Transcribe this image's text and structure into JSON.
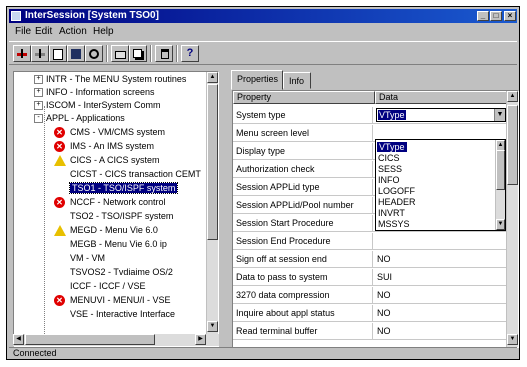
{
  "window": {
    "title": "InterSession [System TSO0]"
  },
  "menu": [
    "File",
    "Edit",
    "Action",
    "Help"
  ],
  "toolbar_icons": [
    "connect-icon",
    "disconnect-icon",
    "new-icon",
    "save-icon",
    "refresh-icon",
    "print-icon",
    "copy-icon",
    "delete-icon",
    "help-icon"
  ],
  "tree": [
    {
      "label": "INTR - The MENU System routines",
      "expander": "+",
      "level": 1
    },
    {
      "label": "INFO - Information screens",
      "expander": "+",
      "level": 1
    },
    {
      "label": "ISCOM - InterSystem Comm",
      "expander": "+",
      "level": 1
    },
    {
      "label": "APPL - Applications",
      "expander": "-",
      "level": 1
    },
    {
      "label": "CMS - VM/CMS system",
      "icon": "stop-icon",
      "level": 2
    },
    {
      "label": "IMS - An IMS system",
      "icon": "stop-icon",
      "level": 2
    },
    {
      "label": "CICS - A CICS system",
      "icon": "warning-icon",
      "level": 2
    },
    {
      "label": "CICST - CICS transaction CEMT",
      "level": 2
    },
    {
      "label": "TSO1 - TSO/ISPF system",
      "level": 2,
      "selected": true
    },
    {
      "label": "NCCF - Network control",
      "icon": "stop-icon",
      "level": 2
    },
    {
      "label": "TSO2 - TSO/ISPF system",
      "level": 2
    },
    {
      "label": "MEGD - Menu Vie 6.0",
      "icon": "warning-icon",
      "level": 2
    },
    {
      "label": "MEGB - Menu Vie 6.0 ip",
      "level": 2
    },
    {
      "label": "VM - VM",
      "level": 2
    },
    {
      "label": "TSVOS2 - Tvdiaime OS/2",
      "level": 2
    },
    {
      "label": "ICCF - ICCF / VSE",
      "level": 2
    },
    {
      "label": "MENUVI - MENU/I - VSE",
      "icon": "stop-icon",
      "level": 2
    },
    {
      "label": "VSE - Interactive Interface",
      "level": 2
    }
  ],
  "tabs": [
    "Properties",
    "Info"
  ],
  "grid": {
    "headers": [
      "Property",
      "Data"
    ],
    "rows": [
      {
        "property": "System type",
        "value": "VType",
        "combo": true
      },
      {
        "property": "Menu screen level",
        "value": ""
      },
      {
        "property": "Display type",
        "value": ""
      },
      {
        "property": "Authorization check",
        "value": ""
      },
      {
        "property": "Session APPLid type",
        "value": ""
      },
      {
        "property": "Session APPLid/Pool number",
        "value": ""
      },
      {
        "property": "Session Start Procedure",
        "value": ""
      },
      {
        "property": "Session End Procedure",
        "value": ""
      },
      {
        "property": "Sign off at session end",
        "value": "NO"
      },
      {
        "property": "Data to pass to system",
        "value": "SUI"
      },
      {
        "property": "3270 data compression",
        "value": "NO"
      },
      {
        "property": "Inquire about appl status",
        "value": "NO"
      },
      {
        "property": "Read terminal buffer",
        "value": "NO"
      }
    ]
  },
  "dropdown": {
    "selected": "VType",
    "options": [
      "VType",
      "CICS",
      "SESS",
      "INFO",
      "LOGOFF",
      "HEADER",
      "INVRT",
      "MSSYS"
    ]
  },
  "status": {
    "text": "Connected"
  }
}
